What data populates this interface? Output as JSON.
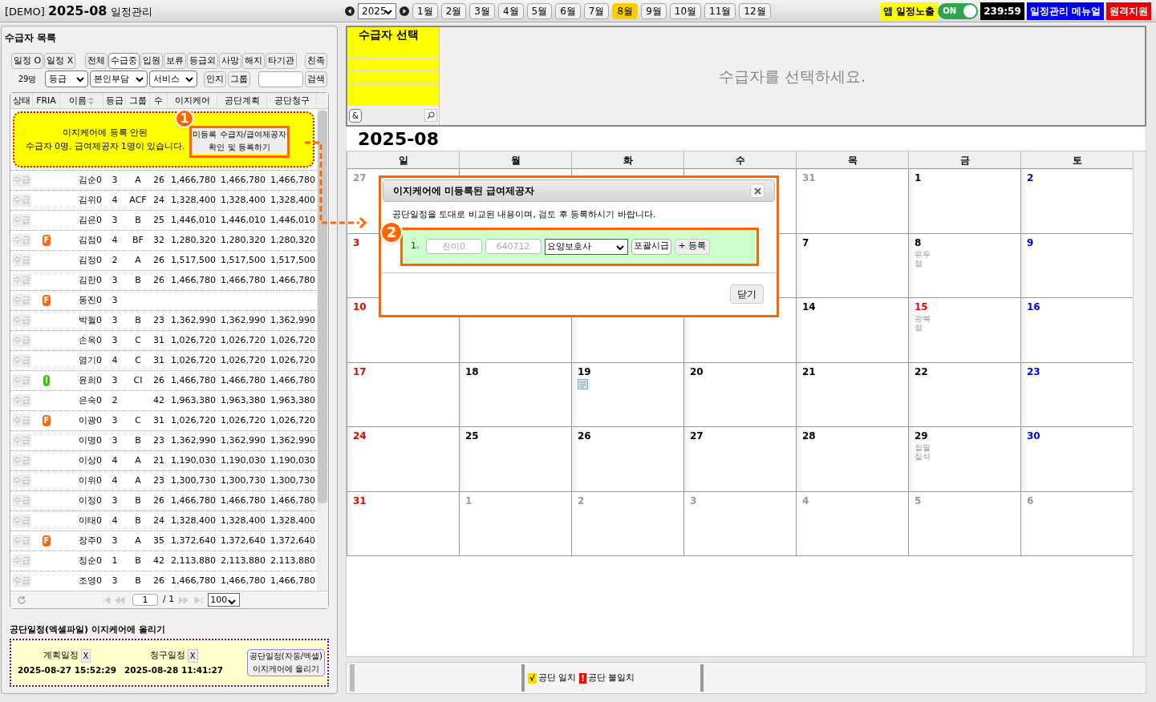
{
  "header": {
    "prefix": "[DEMO]",
    "month": "2025-08",
    "suffix": "일정관리"
  },
  "year_select": "2025",
  "months": [
    {
      "label": "1월",
      "selected": false
    },
    {
      "label": "2월",
      "selected": false
    },
    {
      "label": "3월",
      "selected": false
    },
    {
      "label": "4월",
      "selected": false
    },
    {
      "label": "5월",
      "selected": false
    },
    {
      "label": "6월",
      "selected": false
    },
    {
      "label": "7월",
      "selected": false
    },
    {
      "label": "8월",
      "selected": true
    },
    {
      "label": "9월",
      "selected": false
    },
    {
      "label": "10월",
      "selected": false
    },
    {
      "label": "11월",
      "selected": false
    },
    {
      "label": "12월",
      "selected": false
    }
  ],
  "app_schedule": {
    "label": "앱 일정노출",
    "toggle_label": "ON",
    "on": true
  },
  "clock": "239:59",
  "manual_button": "일정관리 메뉴얼",
  "remote_button": "원격지원",
  "left": {
    "title": "수급자 목록",
    "schedule_filters": [
      "일정 O",
      "일정 X"
    ],
    "status_filters": [
      {
        "label": "전체",
        "selected": false
      },
      {
        "label": "수급중",
        "selected": true
      },
      {
        "label": "입원",
        "selected": false
      },
      {
        "label": "보류",
        "selected": false
      },
      {
        "label": "등급외",
        "selected": false
      },
      {
        "label": "사망",
        "selected": false
      },
      {
        "label": "해지",
        "selected": false
      },
      {
        "label": "타기관",
        "selected": false
      }
    ],
    "family_button": "친족",
    "count": "29명",
    "selects": [
      "등급",
      "본인부담",
      "서비스"
    ],
    "buttons": [
      "인지",
      "그룹"
    ],
    "search_button": "검색",
    "columns": [
      "상태",
      "FRIA",
      "이름",
      "등급",
      "그룹",
      "수",
      "이지케어",
      "공단계획",
      "공단청구"
    ],
    "notice": {
      "lines": [
        "이지케어에 등록 안된",
        "수급자 0명, 급여제공자 1명이 있습니다."
      ],
      "button": "미등록 수급자/급여제공자\n확인 및 등록하기"
    },
    "rows": [
      {
        "status": "수급",
        "name": "김순0",
        "grade": "3",
        "group": "A",
        "count": "26",
        "ezicare": "1,466,780",
        "plan": "1,466,780",
        "claim": "1,466,780"
      },
      {
        "status": "수급",
        "name": "김위0",
        "grade": "4",
        "group": "ACF",
        "count": "24",
        "ezicare": "1,328,400",
        "plan": "1,328,400",
        "claim": "1,328,400"
      },
      {
        "status": "수급",
        "name": "김은0",
        "grade": "3",
        "group": "B",
        "count": "25",
        "ezicare": "1,446,010",
        "plan": "1,446,010",
        "claim": "1,446,010"
      },
      {
        "status": "수급",
        "fria": {
          "label": "F",
          "color": "#ff6600"
        },
        "name": "김점0",
        "grade": "4",
        "group": "BF",
        "count": "32",
        "ezicare": "1,280,320",
        "plan": "1,280,320",
        "claim": "1,280,320"
      },
      {
        "status": "수급",
        "name": "김정0",
        "grade": "2",
        "group": "A",
        "count": "26",
        "ezicare": "1,517,500",
        "plan": "1,517,500",
        "claim": "1,517,500"
      },
      {
        "status": "수급",
        "name": "김한0",
        "grade": "3",
        "group": "B",
        "count": "26",
        "ezicare": "1,466,780",
        "plan": "1,466,780",
        "claim": "1,466,780"
      },
      {
        "status": "수급",
        "fria": {
          "label": "F",
          "color": "#ff6600"
        },
        "name": "동진0",
        "grade": "3"
      },
      {
        "status": "수급",
        "name": "박월0",
        "grade": "3",
        "group": "B",
        "count": "23",
        "ezicare": "1,362,990",
        "plan": "1,362,990",
        "claim": "1,362,990"
      },
      {
        "status": "수급",
        "name": "손옥0",
        "grade": "3",
        "group": "C",
        "count": "31",
        "ezicare": "1,026,720",
        "plan": "1,026,720",
        "claim": "1,026,720"
      },
      {
        "status": "수급",
        "name": "염기0",
        "grade": "4",
        "group": "C",
        "count": "31",
        "ezicare": "1,026,720",
        "plan": "1,026,720",
        "claim": "1,026,720"
      },
      {
        "status": "수급",
        "fria": {
          "label": "I",
          "color": "#33cc00"
        },
        "name": "윤희0",
        "grade": "3",
        "group": "CI",
        "count": "26",
        "ezicare": "1,466,780",
        "plan": "1,466,780",
        "claim": "1,466,780"
      },
      {
        "status": "수급",
        "name": "은숙0",
        "grade": "2",
        "count": "42",
        "ezicare": "1,963,380",
        "plan": "1,963,380",
        "claim": "1,963,380"
      },
      {
        "status": "수급",
        "fria": {
          "label": "F",
          "color": "#ff6600"
        },
        "name": "이광0",
        "grade": "3",
        "group": "C",
        "count": "31",
        "ezicare": "1,026,720",
        "plan": "1,026,720",
        "claim": "1,026,720"
      },
      {
        "status": "수급",
        "name": "이명0",
        "grade": "3",
        "group": "B",
        "count": "23",
        "ezicare": "1,362,990",
        "plan": "1,362,990",
        "claim": "1,362,990"
      },
      {
        "status": "수급",
        "name": "이상0",
        "grade": "4",
        "group": "A",
        "count": "21",
        "ezicare": "1,190,030",
        "plan": "1,190,030",
        "claim": "1,190,030"
      },
      {
        "status": "수급",
        "name": "이위0",
        "grade": "4",
        "group": "A",
        "count": "23",
        "ezicare": "1,300,730",
        "plan": "1,300,730",
        "claim": "1,300,730"
      },
      {
        "status": "수급",
        "name": "이정0",
        "grade": "3",
        "group": "B",
        "count": "26",
        "ezicare": "1,466,780",
        "plan": "1,466,780",
        "claim": "1,466,780"
      },
      {
        "status": "수급",
        "name": "이태0",
        "grade": "4",
        "group": "B",
        "count": "24",
        "ezicare": "1,328,400",
        "plan": "1,328,400",
        "claim": "1,328,400"
      },
      {
        "status": "수급",
        "fria": {
          "label": "F",
          "color": "#ff6600"
        },
        "name": "장주0",
        "grade": "3",
        "group": "A",
        "count": "35",
        "ezicare": "1,372,640",
        "plan": "1,372,640",
        "claim": "1,372,640"
      },
      {
        "status": "수급",
        "name": "정순0",
        "grade": "1",
        "group": "B",
        "count": "42",
        "ezicare": "2,113,880",
        "plan": "2,113,880",
        "claim": "2,113,880"
      },
      {
        "status": "수급",
        "name": "조영0",
        "grade": "3",
        "group": "B",
        "count": "26",
        "ezicare": "1,466,780",
        "plan": "1,466,780",
        "claim": "1,466,780"
      }
    ],
    "pager": {
      "page": "1",
      "total": "/ 1",
      "page_size": "100"
    },
    "upload": {
      "title": "공단일정(엑셀파일) 이지케어에 올리기",
      "items": [
        {
          "label": "계획일정",
          "clear": "X",
          "time": "2025-08-27 15:52:29"
        },
        {
          "label": "청구일정",
          "clear": "X",
          "time": "2025-08-28 11:41:27"
        }
      ],
      "button": "공단일정(자동/엑셀)\n이지케어에 올리기"
    }
  },
  "selector": {
    "title": "수급자 선택",
    "and_button": "&",
    "message": "수급자를 선택하세요."
  },
  "calendar": {
    "title": "2025-08",
    "weekdays": [
      "일",
      "월",
      "화",
      "수",
      "목",
      "금",
      "토"
    ],
    "weeks": [
      [
        {
          "day": "27",
          "kind": "other"
        },
        {
          "kind": "other"
        },
        {
          "kind": "other"
        },
        {
          "kind": "other"
        },
        {
          "day": "31",
          "kind": "other"
        },
        {
          "day": "1",
          "kind": "normal"
        },
        {
          "day": "2",
          "kind": "sat"
        }
      ],
      {
        "before": [
          {
            "day": "3",
            "kind": "sun"
          }
        ],
        "after": [
          {
            "day": "7",
            "kind": "normal"
          },
          {
            "day": "8",
            "kind": "normal",
            "note": "유두절"
          },
          {
            "day": "9",
            "kind": "sat"
          }
        ]
      },
      [
        {
          "day": "10",
          "kind": "sun"
        },
        {
          "kind": "normal"
        },
        {
          "kind": "normal"
        },
        {
          "kind": "normal"
        },
        {
          "day": "14",
          "kind": "normal"
        },
        {
          "day": "15",
          "kind": "holiday",
          "note": "광복절"
        },
        {
          "day": "16",
          "kind": "sat"
        }
      ],
      [
        {
          "day": "17",
          "kind": "sun"
        },
        {
          "day": "18",
          "kind": "normal"
        },
        {
          "day": "19",
          "kind": "normal",
          "memo": true
        },
        {
          "day": "20",
          "kind": "normal"
        },
        {
          "day": "21",
          "kind": "normal"
        },
        {
          "day": "22",
          "kind": "normal"
        },
        {
          "day": "23",
          "kind": "sat"
        }
      ],
      [
        {
          "day": "24",
          "kind": "sun"
        },
        {
          "day": "25",
          "kind": "normal"
        },
        {
          "day": "26",
          "kind": "normal"
        },
        {
          "day": "27",
          "kind": "normal"
        },
        {
          "day": "28",
          "kind": "normal"
        },
        {
          "day": "29",
          "kind": "normal",
          "note": "칠월칠석"
        },
        {
          "day": "30",
          "kind": "sat"
        }
      ],
      [
        {
          "day": "31",
          "kind": "sun"
        },
        {
          "day": "1",
          "kind": "other"
        },
        {
          "day": "2",
          "kind": "other"
        },
        {
          "day": "3",
          "kind": "other"
        },
        {
          "day": "4",
          "kind": "other"
        },
        {
          "day": "5",
          "kind": "other"
        },
        {
          "day": "6",
          "kind": "other"
        }
      ]
    ]
  },
  "legend": [
    {
      "mark": "√",
      "label": "공단 일치",
      "color": "#ffd800"
    },
    {
      "mark": "!",
      "label": "공단 불일치",
      "color": "#ff0000"
    }
  ],
  "dialog": {
    "title": "이지케어에 미등록된 급여제공자",
    "description": "공단일정을 토대로 비교된 내용이며, 검토 후 등록하시기 바랍니다.",
    "entries": [
      {
        "number": "1.",
        "name": "진미0",
        "birth": "640712",
        "role": "요양보호사",
        "pay_button": "포괄시급",
        "register_button": "+ 등록"
      }
    ],
    "close_button": "닫기"
  },
  "annotations": [
    "1",
    "2"
  ]
}
